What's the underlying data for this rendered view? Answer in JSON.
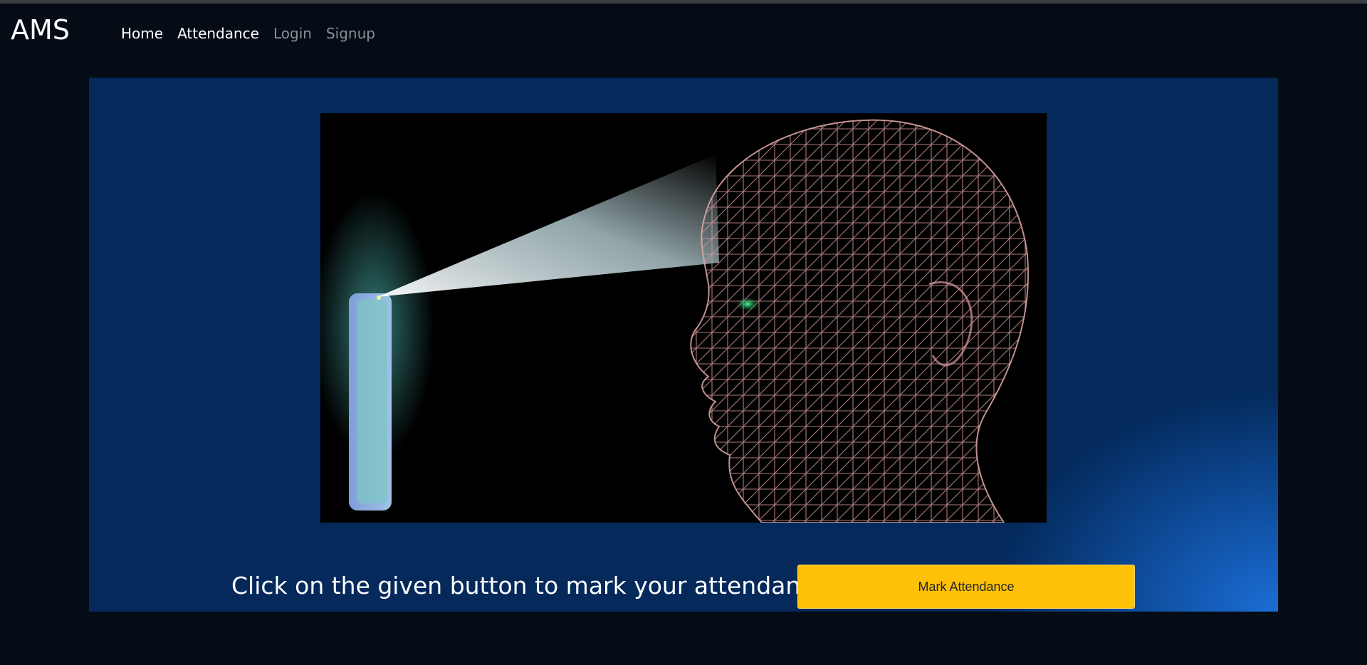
{
  "app": {
    "brand": "AMS"
  },
  "nav": {
    "items": [
      {
        "label": "Home",
        "state": "active"
      },
      {
        "label": "Attendance",
        "state": "active"
      },
      {
        "label": "Login",
        "state": "muted"
      },
      {
        "label": "Signup",
        "state": "muted"
      }
    ]
  },
  "main": {
    "hero_image": "face-scan-illustration",
    "prompt_text": "Click on the given button to mark your attendance",
    "button_label": "Mark Attendance"
  },
  "colors": {
    "page_bg": "#050c16",
    "panel_bg": "#04295a",
    "accent_button": "#ffc107",
    "nav_active": "#ffffff",
    "nav_muted": "#8c9096"
  }
}
